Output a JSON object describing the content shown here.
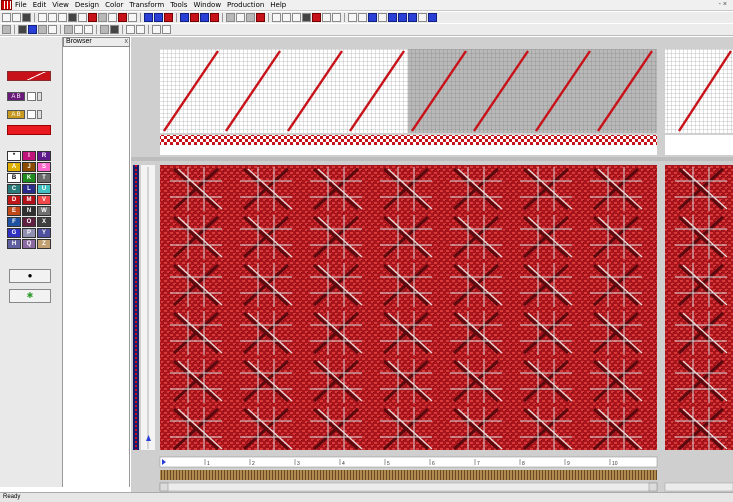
{
  "menu": {
    "items": [
      "File",
      "Edit",
      "View",
      "Design",
      "Color",
      "Transform",
      "Tools",
      "Window",
      "Production",
      "Help"
    ],
    "window_controls": "- ×"
  },
  "browser": {
    "title": "Browser",
    "close": "x"
  },
  "palette": {
    "ab_label_1": "A  B",
    "ab_label_2": "A  B",
    "colors": [
      {
        "label": "*",
        "color": "#ffffff"
      },
      {
        "label": "I",
        "color": "#c0147a"
      },
      {
        "label": "R",
        "color": "#5c1a8a"
      },
      {
        "label": "A",
        "color": "#e0b000"
      },
      {
        "label": "J",
        "color": "#8a4a00"
      },
      {
        "label": "S",
        "color": "#ff66cc"
      },
      {
        "label": "B",
        "color": "#ffffff"
      },
      {
        "label": "K",
        "color": "#1f8a1f"
      },
      {
        "label": "T",
        "color": "#6a6a6a"
      },
      {
        "label": "C",
        "color": "#2a7a7a"
      },
      {
        "label": "L",
        "color": "#2a2a8a"
      },
      {
        "label": "U",
        "color": "#40c0c0"
      },
      {
        "label": "D",
        "color": "#c01818"
      },
      {
        "label": "M",
        "color": "#b01018"
      },
      {
        "label": "V",
        "color": "#f04848"
      },
      {
        "label": "E",
        "color": "#c04818"
      },
      {
        "label": "N",
        "color": "#303030"
      },
      {
        "label": "W",
        "color": "#707070"
      },
      {
        "label": "F",
        "color": "#2050a0"
      },
      {
        "label": "O",
        "color": "#602040"
      },
      {
        "label": "X",
        "color": "#404040"
      },
      {
        "label": "G",
        "color": "#3030c0"
      },
      {
        "label": "P",
        "color": "#9090b0"
      },
      {
        "label": "Y",
        "color": "#5050a0"
      },
      {
        "label": "H",
        "color": "#6060a0"
      },
      {
        "label": "Q",
        "color": "#8a6aa0"
      },
      {
        "label": "Z",
        "color": "#c0a070"
      }
    ]
  },
  "ruler": {
    "marks": [
      "1",
      "2",
      "3",
      "4",
      "5",
      "6",
      "7",
      "8",
      "9",
      "10"
    ]
  },
  "status": {
    "left": "Ready"
  },
  "colors": {
    "accent_red": "#c8121a",
    "cloth_red": "#a8141c",
    "cloth_dark": "#6a0a10",
    "grid_gray": "#b4b4b4"
  }
}
